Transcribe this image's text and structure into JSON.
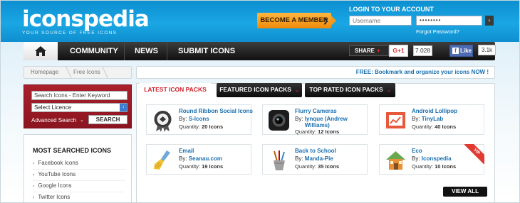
{
  "header": {
    "logo_text": "iconspedia",
    "logo_tagline": "YOUR SOURCE OF FREE ICONS",
    "member_button": "BECOME A MEMBER",
    "member_arrow": "❯",
    "login_title": "LOGIN TO YOUR ACCOUNT",
    "username_placeholder": "Username",
    "password_value": "••••••••",
    "login_go": "›",
    "forgot_password": "Forgot Password?"
  },
  "nav": {
    "items": [
      {
        "label": "COMMUNITY"
      },
      {
        "label": "NEWS"
      },
      {
        "label": "SUBMIT ICONS"
      }
    ],
    "share_label": "SHARE",
    "share_plus": "+",
    "gplus_label": "G+1",
    "gplus_count": "7.028",
    "fb_f": "f",
    "fb_like_label": "Like",
    "fb_count": "3.1k"
  },
  "breadcrumb": {
    "items": [
      "Homepage",
      "Free Icons"
    ]
  },
  "promo_text": "FREE: Bookmark and organize your icons NOW !",
  "search": {
    "input_placeholder": "Search Icons - Enter Keyword",
    "licence_value": "Select Licence",
    "licence_arrow": "↕",
    "advanced_label": "Advanced Search",
    "advanced_chevron": "⌄",
    "search_button": "SEARCH"
  },
  "most_searched": {
    "title": "MOST SEARCHED ICONS",
    "arrow": "›",
    "items": [
      "Facebook Icons",
      "YouTube Icons",
      "Google Icons",
      "Twitter Icons"
    ]
  },
  "tabs": {
    "latest": "LATEST ICON PACKS",
    "featured": "FEATURED ICON PACKS",
    "top_rated": "TOP RATED ICON PACKS",
    "chevron": "⌄"
  },
  "labels": {
    "by": "By:",
    "quantity": "Quantity:"
  },
  "packs": [
    {
      "title": "Round Ribbon Social Icons",
      "author": "S-Icons",
      "quantity": "20 Icons",
      "icon": "ribbon-badge-icon"
    },
    {
      "title": "Flurry Cameras",
      "author": "lynque (Andrew Williams)",
      "quantity": "12 Icons",
      "icon": "camera-icon"
    },
    {
      "title": "Android Lollipop",
      "author": "TinyLab",
      "quantity": "40 Icons",
      "icon": "chart-icon"
    },
    {
      "title": "Email",
      "author": "Seanau.com",
      "quantity": "19 Icons",
      "icon": "broom-icon"
    },
    {
      "title": "Back to School",
      "author": "Manda-Pie",
      "quantity": "35 Icons",
      "icon": "pencil-cup-icon"
    },
    {
      "title": "Eco",
      "author": "Iconspedia",
      "quantity": "10 Icons",
      "icon": "house-icon",
      "badge": "VIP"
    }
  ],
  "view_all": "VIEW ALL"
}
